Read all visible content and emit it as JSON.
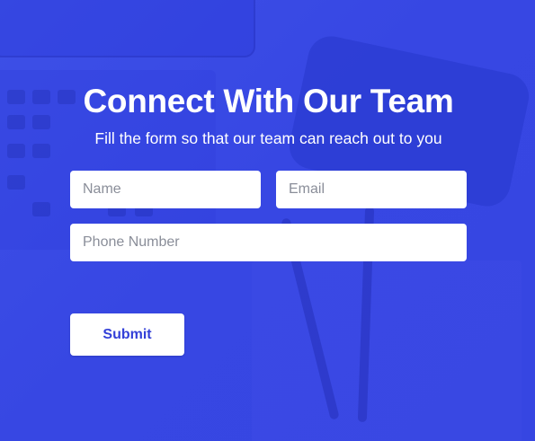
{
  "form": {
    "title": "Connect With Our Team",
    "subtitle": "Fill the form so that our team can reach out to you",
    "name_placeholder": "Name",
    "name_value": "",
    "email_placeholder": "Email",
    "email_value": "",
    "phone_placeholder": "Phone Number",
    "phone_value": "",
    "submit_label": "Submit"
  },
  "colors": {
    "background": "#3a4ce6",
    "button_text": "#3340d8",
    "field_background": "#ffffff",
    "title_text": "#ffffff"
  }
}
